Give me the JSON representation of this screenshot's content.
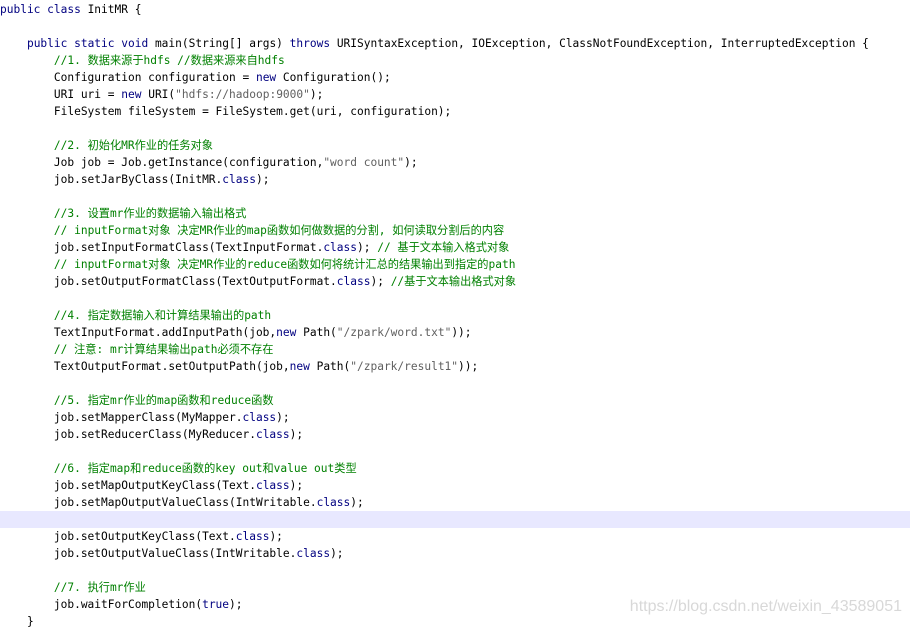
{
  "editor": {
    "current_line_color": "#e8e8ff",
    "keyword_color": "#000080",
    "comment_color": "#008000",
    "string_color": "#606060",
    "lines": [
      [
        {
          "t": "kw",
          "v": "public class "
        },
        {
          "t": "n",
          "v": "InitMR {"
        }
      ],
      [],
      [
        {
          "t": "n",
          "v": "    "
        },
        {
          "t": "kw",
          "v": "public static void "
        },
        {
          "t": "n",
          "v": "main(String[] args) "
        },
        {
          "t": "kw",
          "v": "throws "
        },
        {
          "t": "n",
          "v": "URISyntaxException, IOException, ClassNotFoundException, InterruptedException {"
        }
      ],
      [
        {
          "t": "n",
          "v": "        "
        },
        {
          "t": "cmt",
          "v": "//1. 数据来源于hdfs //数据来源来自hdfs"
        }
      ],
      [
        {
          "t": "n",
          "v": "        Configuration configuration = "
        },
        {
          "t": "kw",
          "v": "new "
        },
        {
          "t": "n",
          "v": "Configuration();"
        }
      ],
      [
        {
          "t": "n",
          "v": "        URI uri = "
        },
        {
          "t": "kw",
          "v": "new "
        },
        {
          "t": "n",
          "v": "URI("
        },
        {
          "t": "str",
          "v": "\"hdfs://hadoop:9000\""
        },
        {
          "t": "n",
          "v": ");"
        }
      ],
      [
        {
          "t": "n",
          "v": "        FileSystem fileSystem = FileSystem.get(uri, configuration);"
        }
      ],
      [],
      [
        {
          "t": "n",
          "v": "        "
        },
        {
          "t": "cmt",
          "v": "//2. 初始化MR作业的任务对象"
        }
      ],
      [
        {
          "t": "n",
          "v": "        Job job = Job.getInstance(configuration,"
        },
        {
          "t": "str",
          "v": "\"word count\""
        },
        {
          "t": "n",
          "v": ");"
        }
      ],
      [
        {
          "t": "n",
          "v": "        job.setJarByClass(InitMR."
        },
        {
          "t": "kw",
          "v": "class"
        },
        {
          "t": "n",
          "v": ");"
        }
      ],
      [],
      [
        {
          "t": "n",
          "v": "        "
        },
        {
          "t": "cmt",
          "v": "//3. 设置mr作业的数据输入输出格式"
        }
      ],
      [
        {
          "t": "n",
          "v": "        "
        },
        {
          "t": "cmt",
          "v": "// inputFormat对象 决定MR作业的map函数如何做数据的分割, 如何读取分割后的内容"
        }
      ],
      [
        {
          "t": "n",
          "v": "        job.setInputFormatClass(TextInputFormat."
        },
        {
          "t": "kw",
          "v": "class"
        },
        {
          "t": "n",
          "v": "); "
        },
        {
          "t": "cmt",
          "v": "// 基于文本输入格式对象"
        }
      ],
      [
        {
          "t": "n",
          "v": "        "
        },
        {
          "t": "cmt",
          "v": "// inputFormat对象 决定MR作业的reduce函数如何将统计汇总的结果输出到指定的path"
        }
      ],
      [
        {
          "t": "n",
          "v": "        job.setOutputFormatClass(TextOutputFormat."
        },
        {
          "t": "kw",
          "v": "class"
        },
        {
          "t": "n",
          "v": "); "
        },
        {
          "t": "cmt",
          "v": "//基于文本输出格式对象"
        }
      ],
      [],
      [
        {
          "t": "n",
          "v": "        "
        },
        {
          "t": "cmt",
          "v": "//4. 指定数据输入和计算结果输出的path"
        }
      ],
      [
        {
          "t": "n",
          "v": "        TextInputFormat.addInputPath(job,"
        },
        {
          "t": "kw",
          "v": "new "
        },
        {
          "t": "n",
          "v": "Path("
        },
        {
          "t": "str",
          "v": "\"/zpark/word.txt\""
        },
        {
          "t": "n",
          "v": "));"
        }
      ],
      [
        {
          "t": "n",
          "v": "        "
        },
        {
          "t": "cmt",
          "v": "// 注意: mr计算结果输出path必须不存在"
        }
      ],
      [
        {
          "t": "n",
          "v": "        TextOutputFormat.setOutputPath(job,"
        },
        {
          "t": "kw",
          "v": "new "
        },
        {
          "t": "n",
          "v": "Path("
        },
        {
          "t": "str",
          "v": "\"/zpark/result1\""
        },
        {
          "t": "n",
          "v": "));"
        }
      ],
      [],
      [
        {
          "t": "n",
          "v": "        "
        },
        {
          "t": "cmt",
          "v": "//5. 指定mr作业的map函数和reduce函数"
        }
      ],
      [
        {
          "t": "n",
          "v": "        job.setMapperClass(MyMapper."
        },
        {
          "t": "kw",
          "v": "class"
        },
        {
          "t": "n",
          "v": ");"
        }
      ],
      [
        {
          "t": "n",
          "v": "        job.setReducerClass(MyReducer."
        },
        {
          "t": "kw",
          "v": "class"
        },
        {
          "t": "n",
          "v": ");"
        }
      ],
      [],
      [
        {
          "t": "n",
          "v": "        "
        },
        {
          "t": "cmt",
          "v": "//6. 指定map和reduce函数的key out和value out类型"
        }
      ],
      [
        {
          "t": "n",
          "v": "        job.setMapOutputKeyClass(Text."
        },
        {
          "t": "kw",
          "v": "class"
        },
        {
          "t": "n",
          "v": ");"
        }
      ],
      [
        {
          "t": "n",
          "v": "        job.setMapOutputValueClass(IntWritable."
        },
        {
          "t": "kw",
          "v": "class"
        },
        {
          "t": "n",
          "v": ");"
        }
      ],
      [],
      [
        {
          "t": "n",
          "v": "        job.setOutputKeyClass(Text."
        },
        {
          "t": "kw",
          "v": "class"
        },
        {
          "t": "n",
          "v": ");"
        }
      ],
      [
        {
          "t": "n",
          "v": "        job.setOutputValueClass(IntWritable."
        },
        {
          "t": "kw",
          "v": "class"
        },
        {
          "t": "n",
          "v": ");"
        }
      ],
      [],
      [
        {
          "t": "n",
          "v": "        "
        },
        {
          "t": "cmt",
          "v": "//7. 执行mr作业"
        }
      ],
      [
        {
          "t": "n",
          "v": "        job.waitForCompletion("
        },
        {
          "t": "kw",
          "v": "true"
        },
        {
          "t": "n",
          "v": ");"
        }
      ],
      [
        {
          "t": "n",
          "v": "    }"
        }
      ]
    ]
  },
  "watermark": "https://blog.csdn.net/weixin_43589051"
}
